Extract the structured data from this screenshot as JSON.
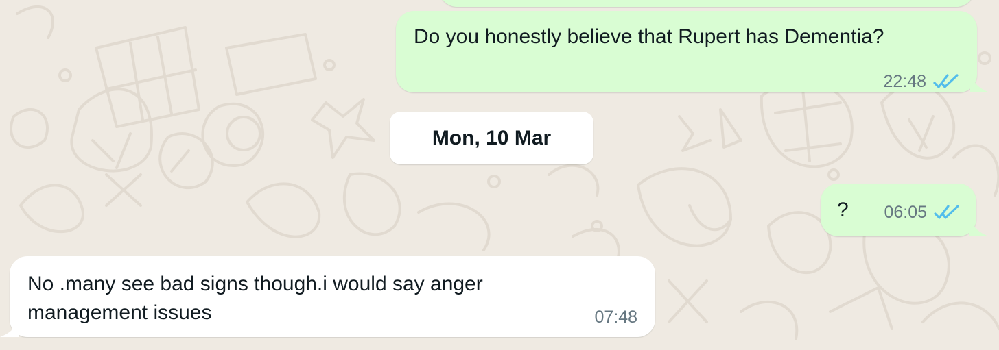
{
  "chat": {
    "messages": [
      {
        "direction": "outgoing",
        "text": "Do you honestly believe that Rupert has Dementia?",
        "time": "22:48",
        "status_icon": "double-check-icon"
      },
      {
        "direction": "outgoing",
        "text": "?",
        "time": "06:05",
        "status_icon": "double-check-icon"
      },
      {
        "direction": "incoming",
        "text": "No .many see bad signs though.i would say anger management issues",
        "time": "07:48"
      }
    ],
    "date_separator": "Mon, 10 Mar"
  },
  "colors": {
    "background": "#efeae2",
    "outgoing_bubble": "#d9fdd3",
    "incoming_bubble": "#ffffff",
    "date_chip": "#ffffff",
    "read_receipt": "#53bdeb",
    "meta_text": "#667781"
  }
}
